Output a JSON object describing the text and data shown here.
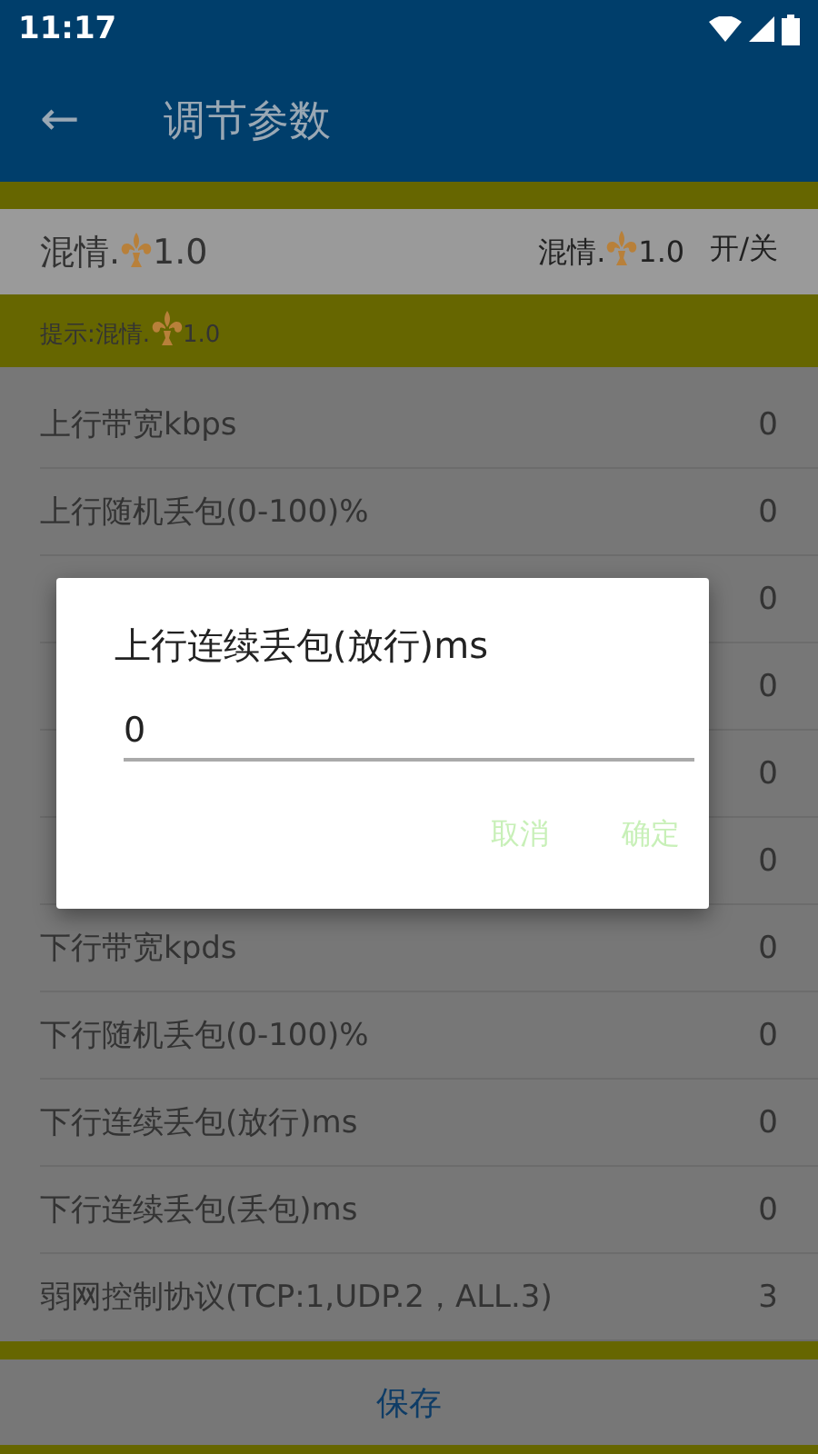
{
  "status_bar": {
    "time": "11:17"
  },
  "app_bar": {
    "back": "←",
    "title": "调节参数"
  },
  "header": {
    "left_before": "混情.",
    "left_after": "1.0",
    "right_before": "混情.",
    "right_after": "1.0",
    "toggle": "开/关"
  },
  "hint": {
    "before": "提示:混情.",
    "after": "1.0"
  },
  "rows": [
    {
      "label": "上行带宽kbps",
      "value": "0"
    },
    {
      "label": "上行随机丢包(0-100)%",
      "value": "0"
    },
    {
      "value": "0"
    },
    {
      "value": "0"
    },
    {
      "value": "0"
    },
    {
      "value": "0"
    },
    {
      "label": "下行带宽kpds",
      "value": "0"
    },
    {
      "label": "下行随机丢包(0-100)%",
      "value": "0"
    },
    {
      "label": "下行连续丢包(放行)ms",
      "value": "0"
    },
    {
      "label": "下行连续丢包(丢包)ms",
      "value": "0"
    },
    {
      "label": "弱网控制协议(TCP:1,UDP.2，ALL.3)",
      "value": "3"
    }
  ],
  "save": "保存",
  "dialog": {
    "title": "上行连续丢包(放行)ms",
    "value": "0",
    "buttons": [
      "取消",
      "确定"
    ]
  }
}
